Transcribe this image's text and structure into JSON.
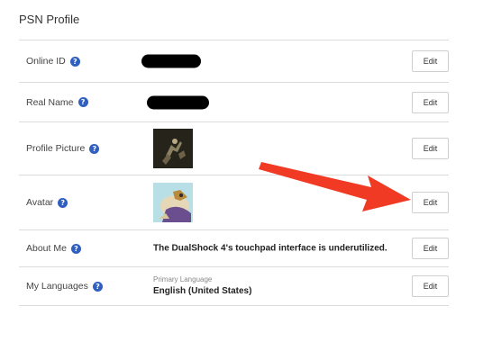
{
  "page": {
    "title": "PSN Profile"
  },
  "rows": {
    "online_id": {
      "label": "Online ID",
      "edit": "Edit"
    },
    "real_name": {
      "label": "Real Name",
      "edit": "Edit"
    },
    "profile_picture": {
      "label": "Profile Picture",
      "edit": "Edit"
    },
    "avatar": {
      "label": "Avatar",
      "edit": "Edit"
    },
    "about_me": {
      "label": "About Me",
      "value": "The DualShock 4's touchpad interface is underutilized.",
      "edit": "Edit"
    },
    "languages": {
      "label": "My Languages",
      "caption": "Primary Language",
      "value": "English (United States)",
      "edit": "Edit"
    }
  },
  "help_glyph": "?",
  "colors": {
    "help_icon": "#2f5fbf",
    "annotation_arrow": "#f03a24",
    "redaction": "#000000"
  }
}
